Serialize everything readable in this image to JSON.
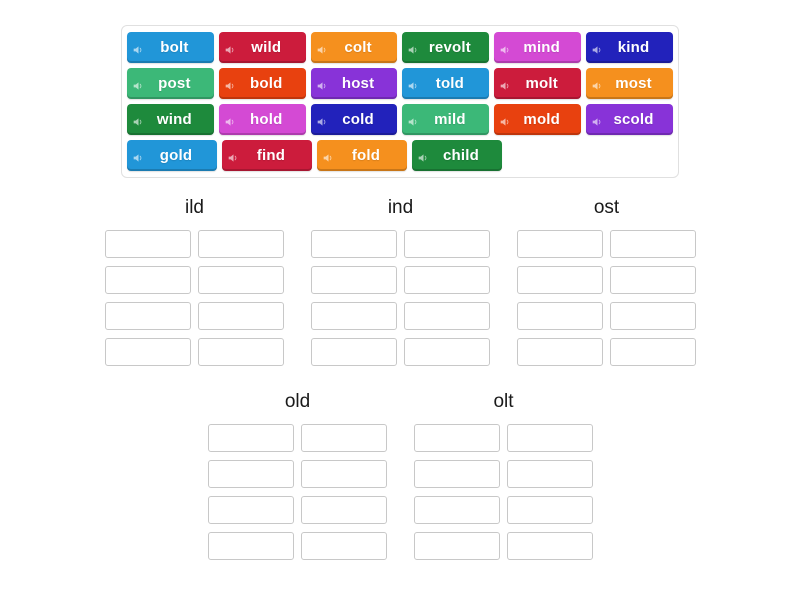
{
  "word_bank": {
    "rows": [
      [
        {
          "word": "bolt",
          "color": "#2196d8",
          "audio_icon": "speaker-icon"
        },
        {
          "word": "wild",
          "color": "#cc1c3c",
          "audio_icon": "speaker-icon"
        },
        {
          "word": "colt",
          "color": "#f5901e",
          "audio_icon": "speaker-icon"
        },
        {
          "word": "revolt",
          "color": "#1e8a3c",
          "audio_icon": "speaker-icon"
        },
        {
          "word": "mind",
          "color": "#d44ad4",
          "audio_icon": "speaker-icon"
        },
        {
          "word": "kind",
          "color": "#2222bb",
          "audio_icon": "speaker-icon"
        }
      ],
      [
        {
          "word": "post",
          "color": "#3cb878",
          "audio_icon": "speaker-icon"
        },
        {
          "word": "bold",
          "color": "#e8410f",
          "audio_icon": "speaker-icon"
        },
        {
          "word": "host",
          "color": "#8833d8",
          "audio_icon": "speaker-icon"
        },
        {
          "word": "told",
          "color": "#2196d8",
          "audio_icon": "speaker-icon"
        },
        {
          "word": "molt",
          "color": "#cc1c3c",
          "audio_icon": "speaker-icon"
        },
        {
          "word": "most",
          "color": "#f5901e",
          "audio_icon": "speaker-icon"
        }
      ],
      [
        {
          "word": "wind",
          "color": "#1e8a3c",
          "audio_icon": "speaker-icon"
        },
        {
          "word": "hold",
          "color": "#d44ad4",
          "audio_icon": "speaker-icon"
        },
        {
          "word": "cold",
          "color": "#2222bb",
          "audio_icon": "speaker-icon"
        },
        {
          "word": "mild",
          "color": "#3cb878",
          "audio_icon": "speaker-icon"
        },
        {
          "word": "mold",
          "color": "#e8410f",
          "audio_icon": "speaker-icon"
        },
        {
          "word": "scold",
          "color": "#8833d8",
          "audio_icon": "speaker-icon"
        }
      ],
      [
        {
          "word": "gold",
          "color": "#2196d8",
          "audio_icon": "speaker-icon"
        },
        {
          "word": "find",
          "color": "#cc1c3c",
          "audio_icon": "speaker-icon"
        },
        {
          "word": "fold",
          "color": "#f5901e",
          "audio_icon": "speaker-icon"
        },
        {
          "word": "child",
          "color": "#1e8a3c",
          "audio_icon": "speaker-icon"
        }
      ]
    ]
  },
  "categories": {
    "row1": [
      {
        "title": "ild",
        "slot_rows": 4,
        "slots_per_row": 2
      },
      {
        "title": "ind",
        "slot_rows": 4,
        "slots_per_row": 2
      },
      {
        "title": "ost",
        "slot_rows": 4,
        "slots_per_row": 2
      }
    ],
    "row2": [
      {
        "title": "old",
        "slot_rows": 4,
        "slots_per_row": 2
      },
      {
        "title": "olt",
        "slot_rows": 4,
        "slots_per_row": 2
      }
    ]
  },
  "colors": {
    "page_background": "#ffffff",
    "bank_border": "#e0e0e0",
    "slot_border": "#c8c8c8",
    "title_text": "#1a1a1a",
    "tile_text": "#ffffff"
  }
}
